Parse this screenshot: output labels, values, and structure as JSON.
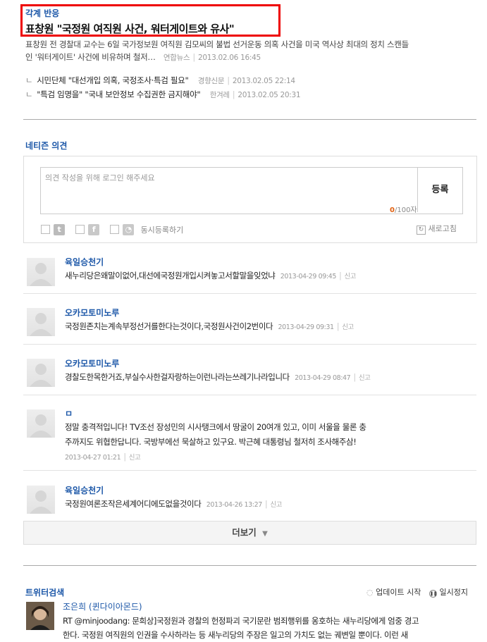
{
  "article": {
    "section_label": "각계 반응",
    "headline": "표창원 \"국정원 여직원 사건, 워터게이트와 유사\"",
    "summary_line1": "표창원 전 경찰대 교수는 6일 국가정보원 여직원 김모씨의 불법 선거운동 의혹 사건을 미국 역사상 최대의 정치 스캔들",
    "summary_line2": "인 '워터게이트' 사건에 비유하며 철저…",
    "source": "연합뉴스",
    "date": "2013.02.06 16:45"
  },
  "related": [
    {
      "title": "시민단체 \"대선개입 의혹, 국정조사·특검 필요\"",
      "source": "경향신문",
      "date": "2013.02.05 22:14"
    },
    {
      "title": "\"특검 임명을\" \"국내 보안정보 수집권한 금지해야\"",
      "source": "한겨레",
      "date": "2013.02.05 20:31"
    }
  ],
  "netizen": {
    "heading": "네티즌 의견",
    "placeholder": "의견 작성을 위해 로그인 해주세요",
    "submit_label": "등록",
    "count_current": "0",
    "count_max": "/100자",
    "share_label": "동시등록하기",
    "refresh_label": "새로고침"
  },
  "comments": [
    {
      "name": "육일승천기",
      "lines": [
        "새누리당은왜말이없어,대선에국정원개입시켜놓고서할말을잊었냐"
      ],
      "date": "2013-04-29 09:45",
      "report": "신고"
    },
    {
      "name": "오카모토미노루",
      "lines": [
        "국정원존치는계속부정선거를한다는것이다,국정원사건이2번이다"
      ],
      "date": "2013-04-29 09:31",
      "report": "신고"
    },
    {
      "name": "오카모토미노루",
      "lines": [
        "경찰도한목한거죠,부실수사한걸자랑하는이런나라는쓰레기나라입니다"
      ],
      "date": "2013-04-29 08:47",
      "report": "신고"
    },
    {
      "name": "ㅁ",
      "lines": [
        "정말 충격적입니다! TV조선 장성민의 시사탱크에서 땅굴이 20여개 있고, 이미 서울을 물론 충",
        "주까지도 위협한답니다. 국방부에선 묵살하고 있구요. 박근혜 대통령님 철저히 조사해주삼!"
      ],
      "date": "2013-04-27 01:21",
      "report": "신고"
    },
    {
      "name": "육일승천기",
      "lines": [
        "국정원여론조작은세계어디에도없을것이다"
      ],
      "date": "2013-04-26 13:27",
      "report": "신고"
    }
  ],
  "more_label": "더보기",
  "twitter": {
    "heading": "트위터검색",
    "update_label": "업데이트 시작",
    "pause_label": "일시정지",
    "user": "조은희 (퀸다이아몬드)",
    "text_line1": "RT @minjoodang: 문희상]국정원과 경찰의 헌정파괴 국기문란 범죄행위를 옹호하는 새누리당에게 엄중 경고",
    "text_line2": "한다. 국정원 여직원의 인권을 수사하라는 등 새누리당의 주장은 일고의 가치도 없는 궤변일 뿐이다. 이런 새"
  },
  "colors": {
    "accent_blue": "#1c57a8",
    "highlight_red": "#e00000",
    "counter_orange": "#e06010"
  }
}
